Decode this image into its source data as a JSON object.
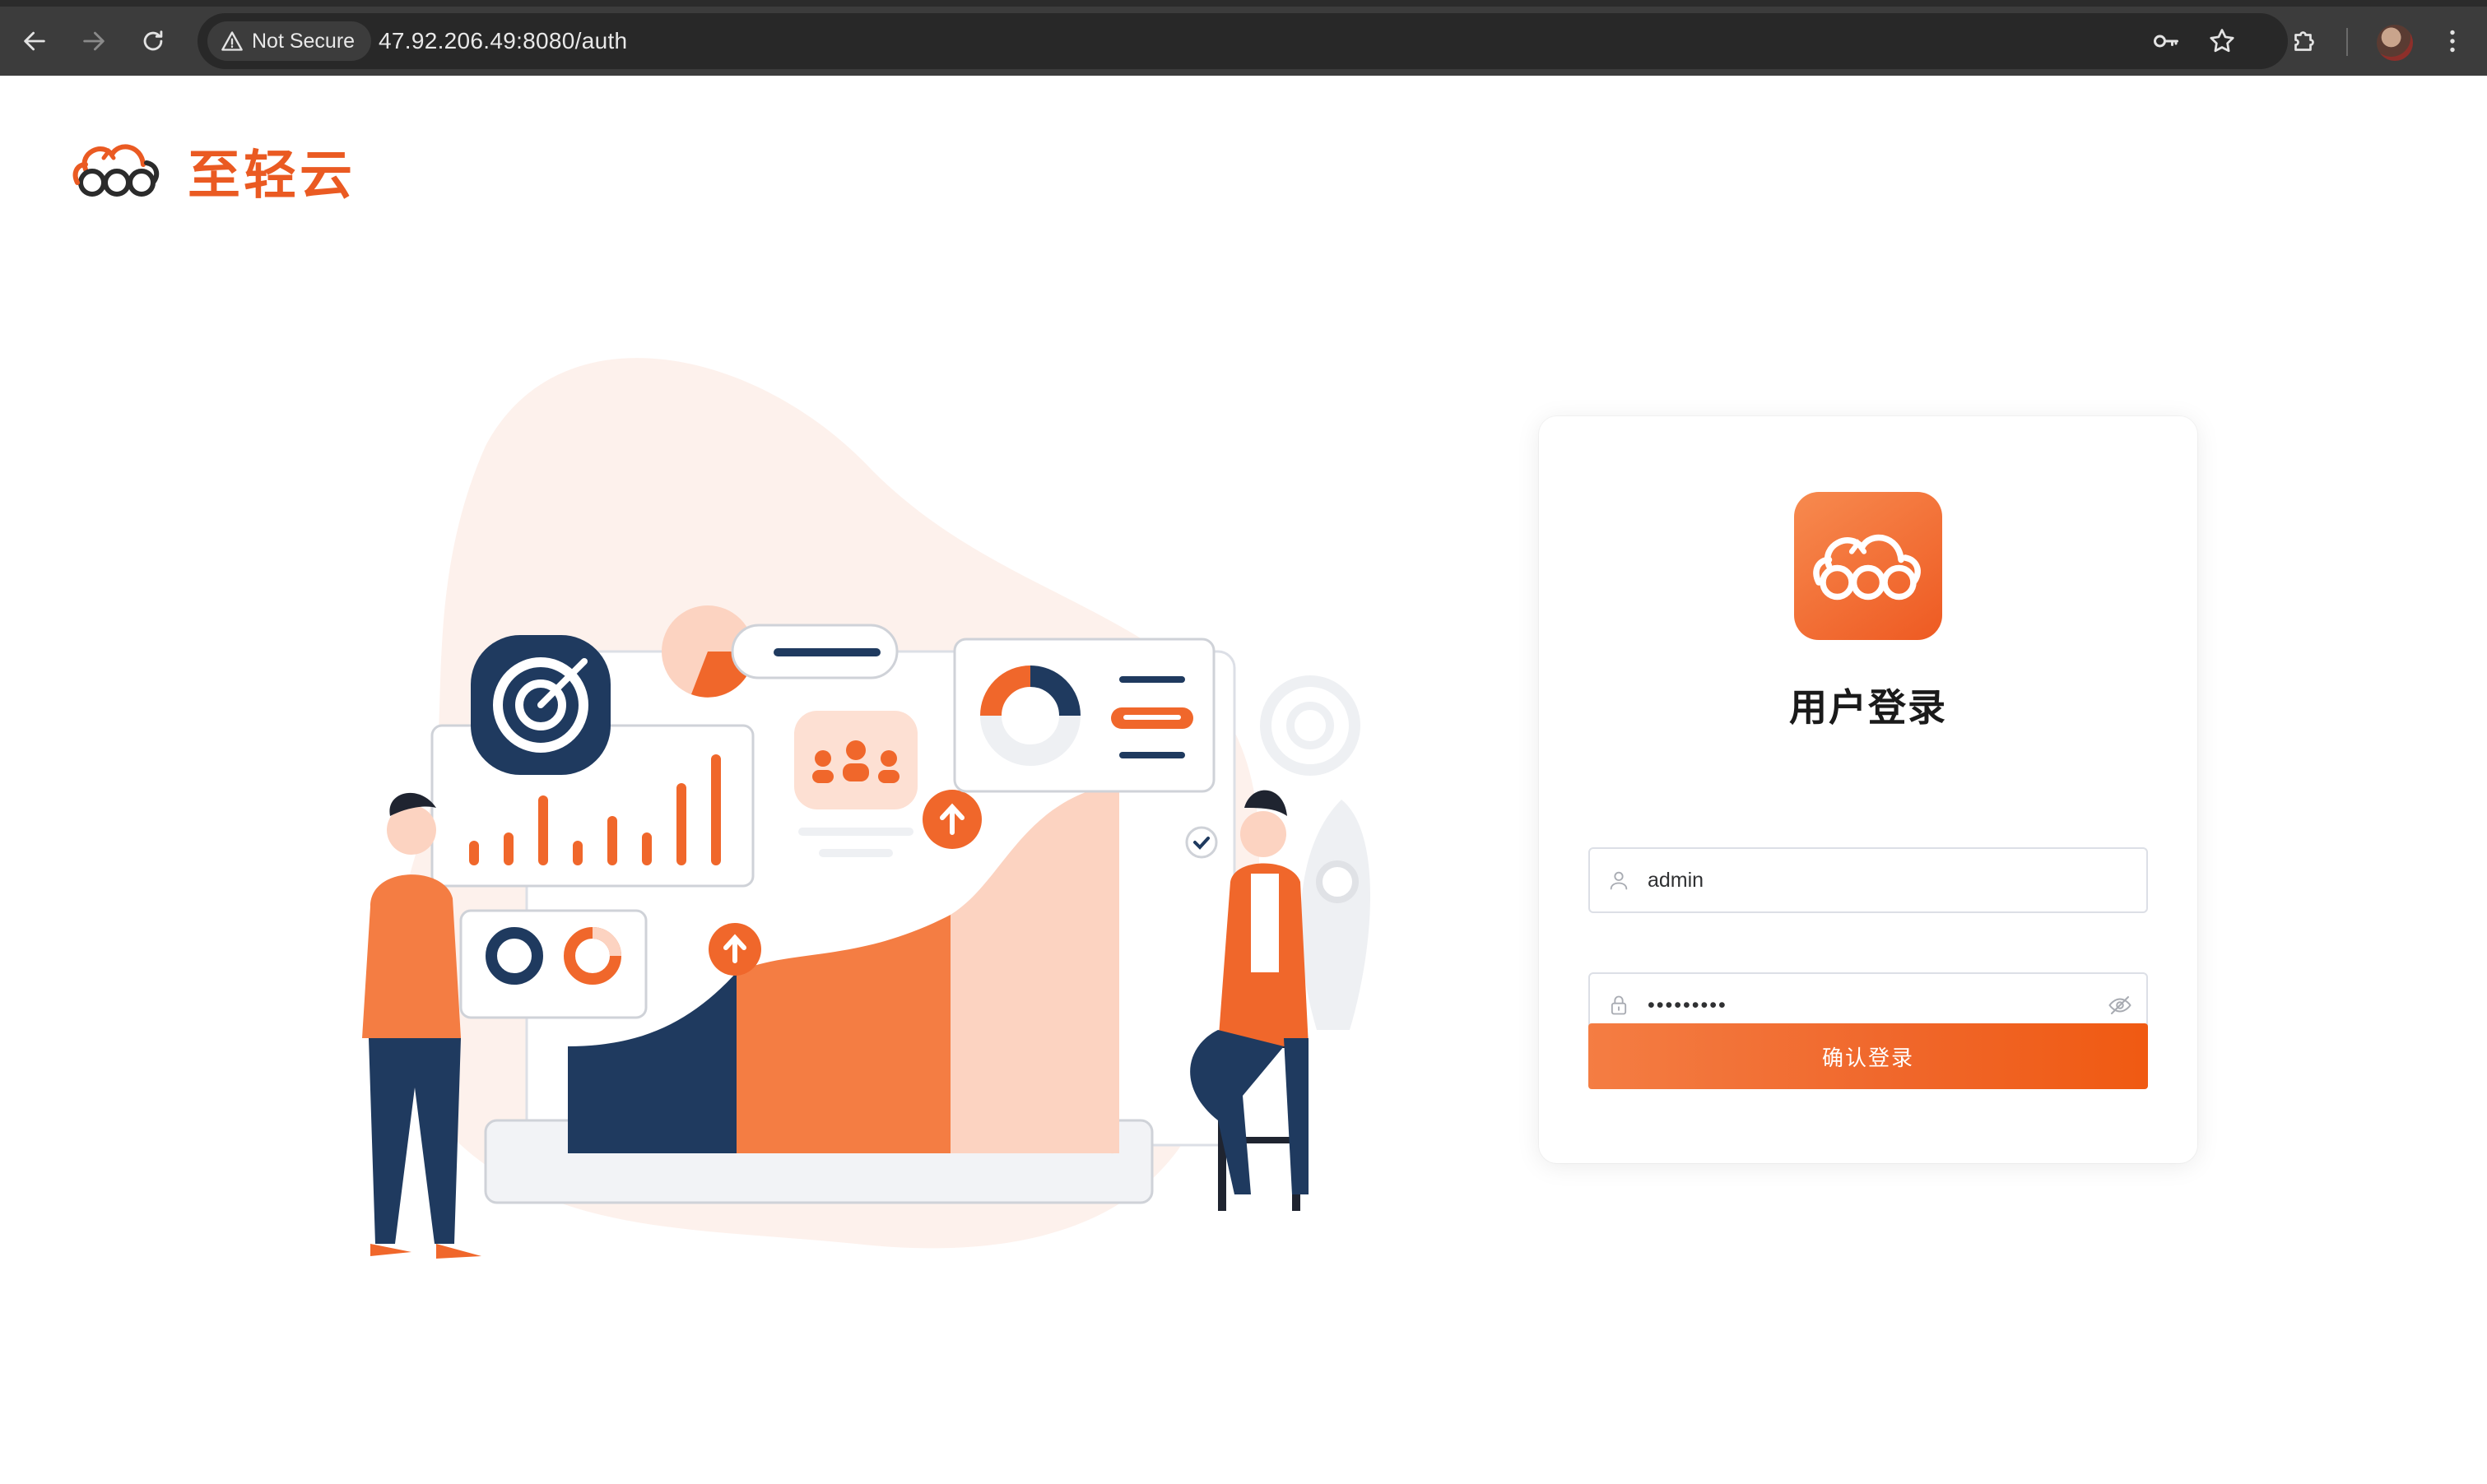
{
  "browser": {
    "security_label": "Not Secure",
    "url": "47.92.206.49:8080/auth"
  },
  "brand": {
    "name": "至轻云",
    "color": "#ea5a22"
  },
  "login": {
    "title": "用户登录",
    "username_value": "admin",
    "password_value": "•••••••••",
    "submit_label": "确认登录"
  },
  "colors": {
    "accent": "#f0672b",
    "navy": "#1f3a5f",
    "peach": "#fcd3c1"
  },
  "icons": {
    "back": "arrow-left-icon",
    "forward": "arrow-right-icon",
    "reload": "reload-icon",
    "warning": "warning-triangle-icon",
    "password_key": "key-icon",
    "bookmark": "star-icon",
    "extensions": "puzzle-icon",
    "menu": "kebab-menu-icon",
    "user": "user-icon",
    "lock": "lock-icon",
    "eye": "eye-off-icon"
  }
}
